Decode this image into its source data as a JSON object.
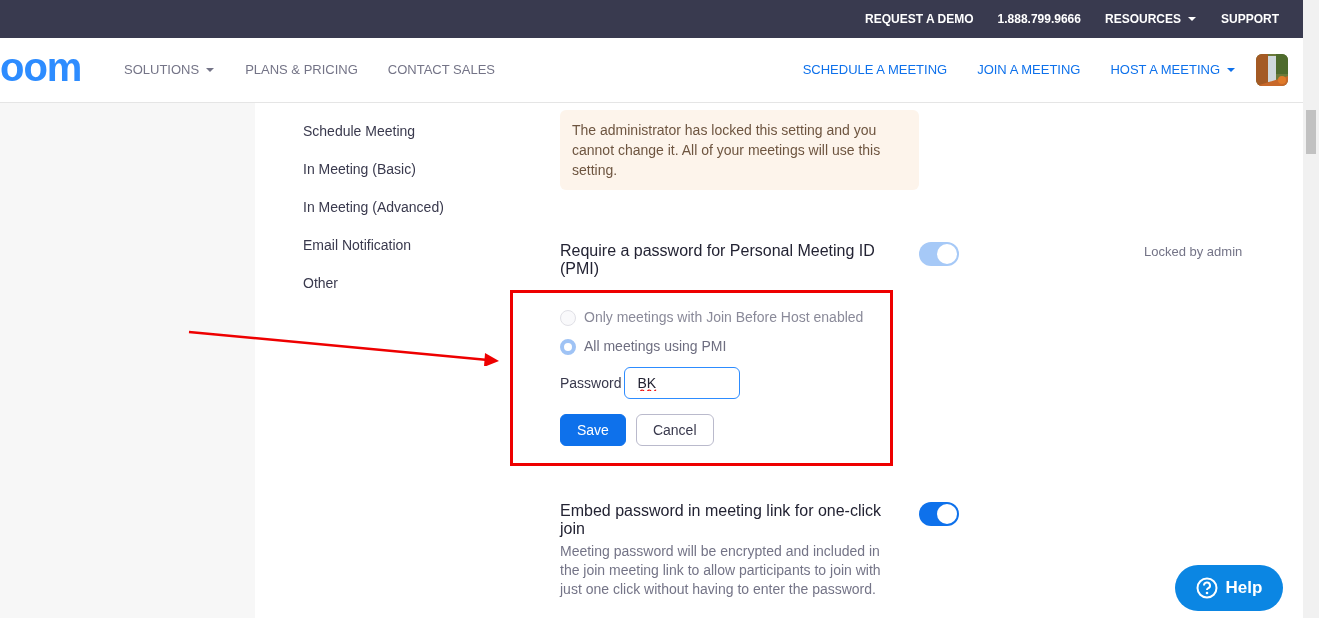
{
  "top_bar": {
    "links": [
      {
        "label": "REQUEST A DEMO",
        "dropdown": false
      },
      {
        "label": "1.888.799.9666",
        "dropdown": false
      },
      {
        "label": "RESOURCES",
        "dropdown": true
      },
      {
        "label": "SUPPORT",
        "dropdown": false
      }
    ]
  },
  "header": {
    "logo": "oom",
    "nav": [
      {
        "label": "SOLUTIONS",
        "dropdown": true
      },
      {
        "label": "PLANS & PRICING",
        "dropdown": false
      },
      {
        "label": "CONTACT SALES",
        "dropdown": false
      }
    ],
    "actions": [
      {
        "label": "SCHEDULE A MEETING",
        "dropdown": false
      },
      {
        "label": "JOIN A MEETING",
        "dropdown": false
      },
      {
        "label": "HOST A MEETING",
        "dropdown": true
      }
    ]
  },
  "sidebar": {
    "items": [
      {
        "label": "Schedule Meeting",
        "selected": false
      },
      {
        "label": "In Meeting (Basic)",
        "selected": false
      },
      {
        "label": "In Meeting (Advanced)",
        "selected": false
      },
      {
        "label": "Email Notification",
        "selected": false
      },
      {
        "label": "Other",
        "selected": false
      }
    ]
  },
  "notice": "The administrator has locked this setting and you cannot change it. All of your meetings will use this setting.",
  "settings": [
    {
      "title": "Require a password for Personal Meeting ID (PMI)",
      "on": true,
      "disabled": true,
      "status": "Locked by admin",
      "options": [
        {
          "label": "Only meetings with Join Before Host enabled",
          "selected": false,
          "disabled": true
        },
        {
          "label": "All meetings using PMI",
          "selected": true,
          "disabled": false
        }
      ],
      "password": {
        "label": "Password",
        "value": "BK"
      },
      "buttons": [
        {
          "label": "Save",
          "kind": "primary"
        },
        {
          "label": "Cancel",
          "kind": "secondary"
        }
      ]
    },
    {
      "title": "Embed password in meeting link for one-click join",
      "on": true,
      "description": "Meeting password will be encrypted and included in the join meeting link to allow participants to join with just one click without having to enter the password."
    }
  ],
  "help_button": "Help"
}
